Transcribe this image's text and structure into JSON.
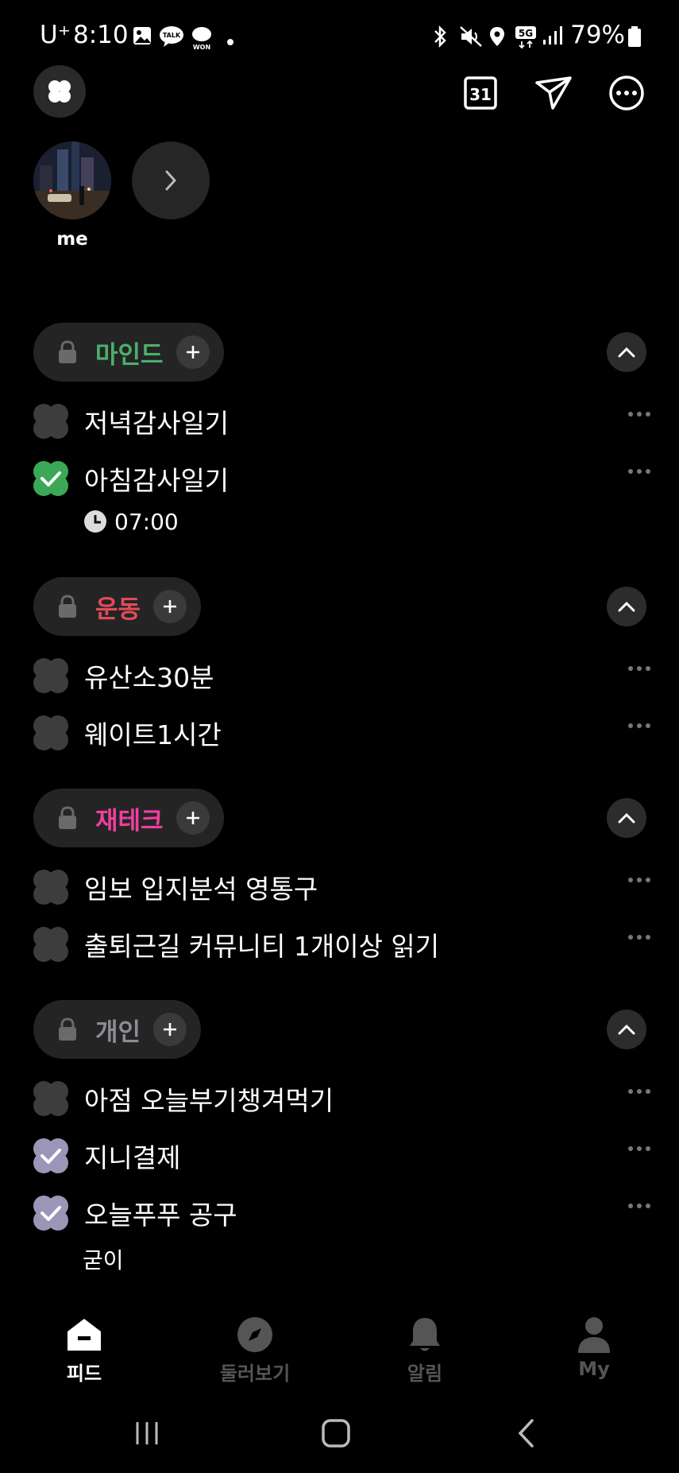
{
  "status": {
    "carrier": "U⁺",
    "time": "8:10",
    "battery": "79%"
  },
  "stories": {
    "me_label": "me"
  },
  "colors": {
    "mind": "#4caf6a",
    "exercise": "#e14b5a",
    "finance": "#ef3fa0",
    "personal": "#8c8c95",
    "check_green": "#3aa856",
    "check_purple": "#9d95b8",
    "unchecked": "#3d3d3d"
  },
  "sections": [
    {
      "label": "마인드",
      "tasks": [
        {
          "label": "저녁감사일기",
          "checked": false
        },
        {
          "label": "아침감사일기",
          "checked": true,
          "time": "07:00"
        }
      ]
    },
    {
      "label": "운동",
      "tasks": [
        {
          "label": "유산소30분",
          "checked": false
        },
        {
          "label": "웨이트1시간",
          "checked": false
        }
      ]
    },
    {
      "label": "재테크",
      "tasks": [
        {
          "label": "임보 입지분석 영통구",
          "checked": false
        },
        {
          "label": "출퇴근길 커뮤니티 1개이상 읽기",
          "checked": false
        }
      ]
    },
    {
      "label": "개인",
      "tasks": [
        {
          "label": "아점 오늘부기챙겨먹기",
          "checked": false
        },
        {
          "label": "지니결제",
          "checked": true
        },
        {
          "label": "오늘푸푸 공구",
          "checked": true,
          "note": "굳이"
        }
      ]
    }
  ],
  "nav": {
    "feed": "피드",
    "explore": "둘러보기",
    "alerts": "알림",
    "my": "My"
  },
  "icons": {
    "calendar_day": "31"
  }
}
